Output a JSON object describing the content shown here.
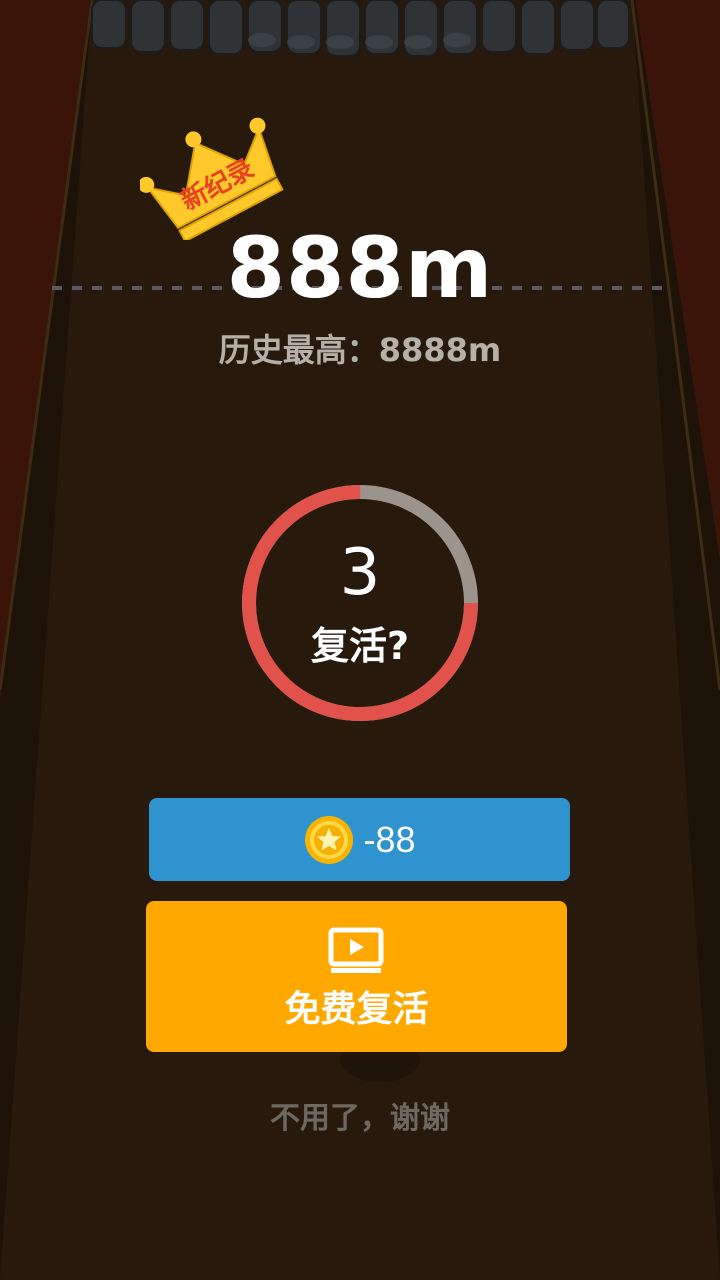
{
  "record": {
    "badge_text": "新纪录",
    "score": "888m",
    "best_label": "历史最高：8888m"
  },
  "revive": {
    "countdown": "3",
    "question": "复活?",
    "progress_fraction": 0.75
  },
  "buttons": {
    "coin_cost": "-88",
    "free_revive_label": "免费复活",
    "no_thanks_label": "不用了，谢谢"
  },
  "colors": {
    "ring_active": "#e0524a",
    "ring_remaining": "#9a948d",
    "coin_button": "#2f93cf",
    "free_button": "#ffa800",
    "crown": "#ffc82b"
  },
  "icons": [
    "crown-icon",
    "coin-icon",
    "video-play-icon"
  ]
}
